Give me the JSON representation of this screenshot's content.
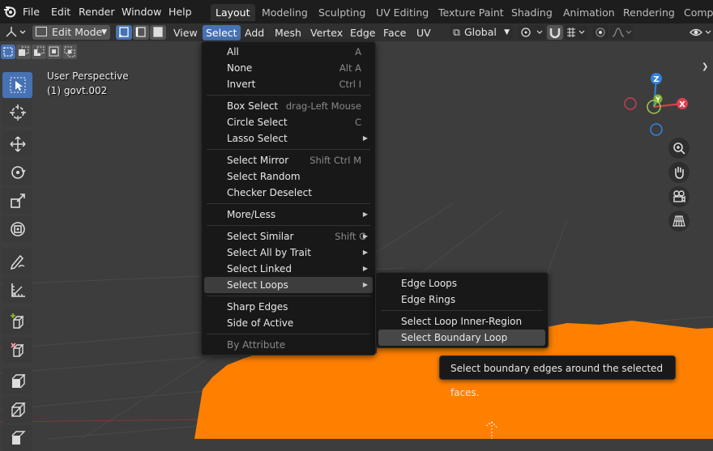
{
  "topbar": {
    "menus": [
      "File",
      "Edit",
      "Render",
      "Window",
      "Help"
    ],
    "workspaces": [
      "Layout",
      "Modeling",
      "Sculpting",
      "UV Editing",
      "Texture Paint",
      "Shading",
      "Animation",
      "Rendering",
      "Compo"
    ],
    "active_workspace": "Layout"
  },
  "header": {
    "mode": "Edit Mode",
    "menus": [
      "View",
      "Select",
      "Add",
      "Mesh",
      "Vertex",
      "Edge",
      "Face",
      "UV"
    ],
    "active_menu": "Select",
    "orientation": "Global"
  },
  "viewport": {
    "perspective": "User Perspective",
    "object": "(1) govt.002",
    "gizmo": {
      "z": "Z",
      "y": "Y",
      "x": "X"
    }
  },
  "select_menu": {
    "items": [
      {
        "label": "All",
        "shortcut": "A"
      },
      {
        "label": "None",
        "shortcut": "Alt A"
      },
      {
        "label": "Invert",
        "shortcut": "Ctrl I"
      },
      {
        "label": "Box Select",
        "shortcut": "drag-Left Mouse"
      },
      {
        "label": "Circle Select",
        "shortcut": "C"
      },
      {
        "label": "Lasso Select",
        "shortcut": ""
      },
      {
        "label": "Select Mirror",
        "shortcut": "Shift Ctrl M"
      },
      {
        "label": "Select Random",
        "shortcut": ""
      },
      {
        "label": "Checker Deselect",
        "shortcut": ""
      },
      {
        "label": "More/Less",
        "shortcut": ""
      },
      {
        "label": "Select Similar",
        "shortcut": "Shift G"
      },
      {
        "label": "Select All by Trait",
        "shortcut": ""
      },
      {
        "label": "Select Linked",
        "shortcut": ""
      },
      {
        "label": "Select Loops",
        "shortcut": ""
      },
      {
        "label": "Sharp Edges",
        "shortcut": ""
      },
      {
        "label": "Side of Active",
        "shortcut": ""
      },
      {
        "label": "By Attribute",
        "shortcut": ""
      }
    ]
  },
  "loops_submenu": {
    "items": [
      "Edge Loops",
      "Edge Rings",
      "Select Loop Inner-Region",
      "Select Boundary Loop"
    ]
  },
  "tooltip": "Select boundary edges around the selected faces.",
  "colors": {
    "accent": "#4772b3",
    "mesh": "#ff8000",
    "axis_x": "#e0404f",
    "axis_y": "#7fb02c",
    "axis_z": "#2f84e3"
  }
}
